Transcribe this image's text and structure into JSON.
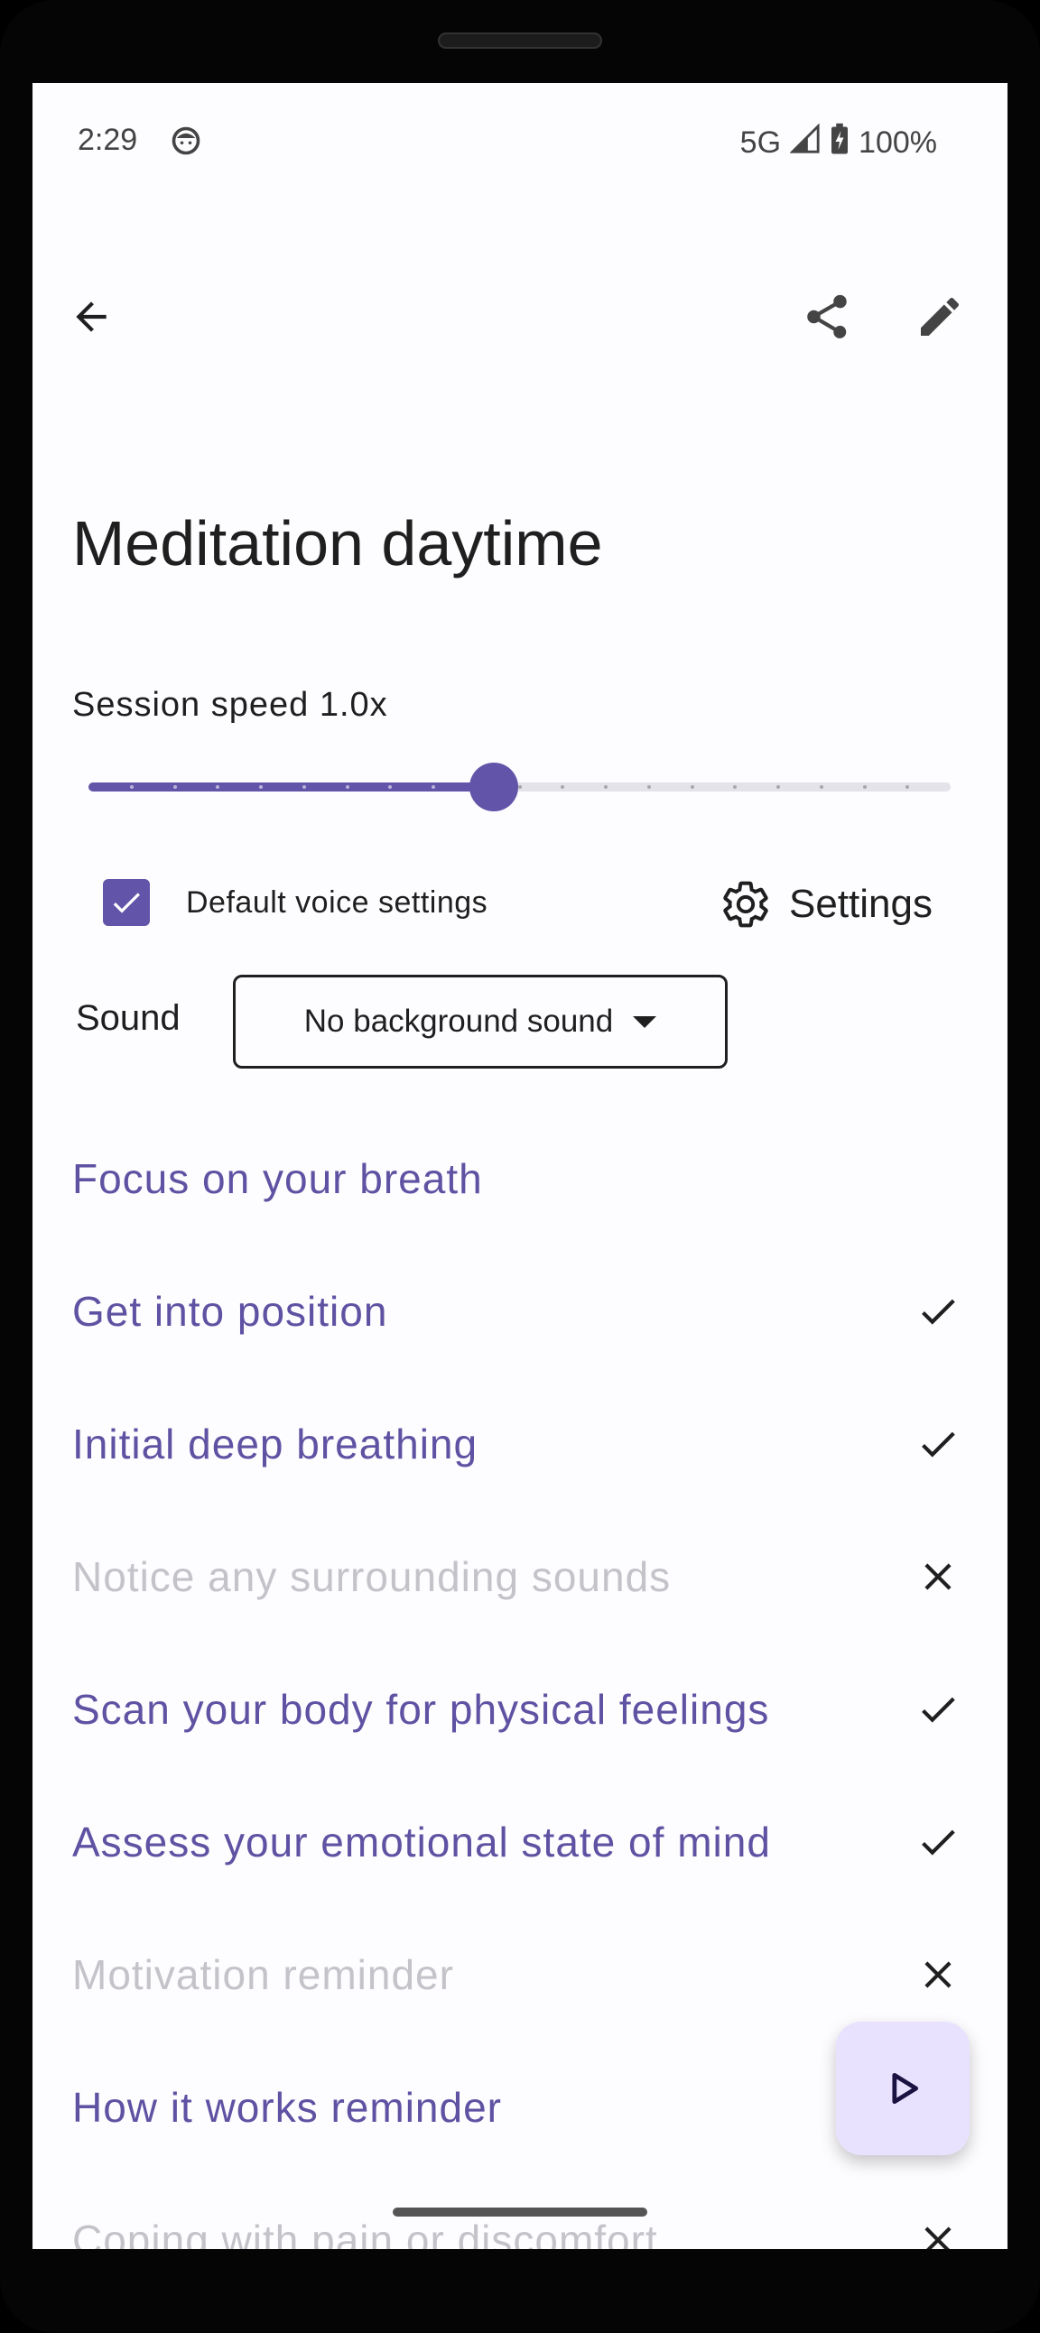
{
  "status_bar": {
    "time": "2:29",
    "network": "5G",
    "battery": "100%"
  },
  "app_bar": {
    "back_icon": "arrow-left-icon",
    "share_icon": "share-icon",
    "edit_icon": "pencil-icon"
  },
  "page": {
    "title": "Meditation daytime"
  },
  "speed": {
    "label": "Session speed 1.0x",
    "slider_fraction": 0.47,
    "steps": 20
  },
  "voice": {
    "default_label": "Default voice settings",
    "checked": true,
    "settings_label": "Settings"
  },
  "sound": {
    "label": "Sound",
    "selected": "No background sound"
  },
  "steps": [
    {
      "label": "Focus on your breath",
      "enabled": true,
      "mark": "none"
    },
    {
      "label": "Get into position",
      "enabled": true,
      "mark": "check"
    },
    {
      "label": "Initial deep breathing",
      "enabled": true,
      "mark": "check"
    },
    {
      "label": "Notice any surrounding sounds",
      "enabled": false,
      "mark": "cross"
    },
    {
      "label": "Scan your body for physical feelings",
      "enabled": true,
      "mark": "check"
    },
    {
      "label": "Assess your emotional state of mind",
      "enabled": true,
      "mark": "check"
    },
    {
      "label": "Motivation reminder",
      "enabled": false,
      "mark": "cross"
    },
    {
      "label": "How it works reminder",
      "enabled": true,
      "mark": "check"
    },
    {
      "label": "Coping with pain or discomfort",
      "enabled": false,
      "mark": "cross"
    }
  ],
  "colors": {
    "accent": "#6254a8",
    "fab_bg": "#e8e2ff",
    "disabled_text": "#c5c3ca"
  }
}
